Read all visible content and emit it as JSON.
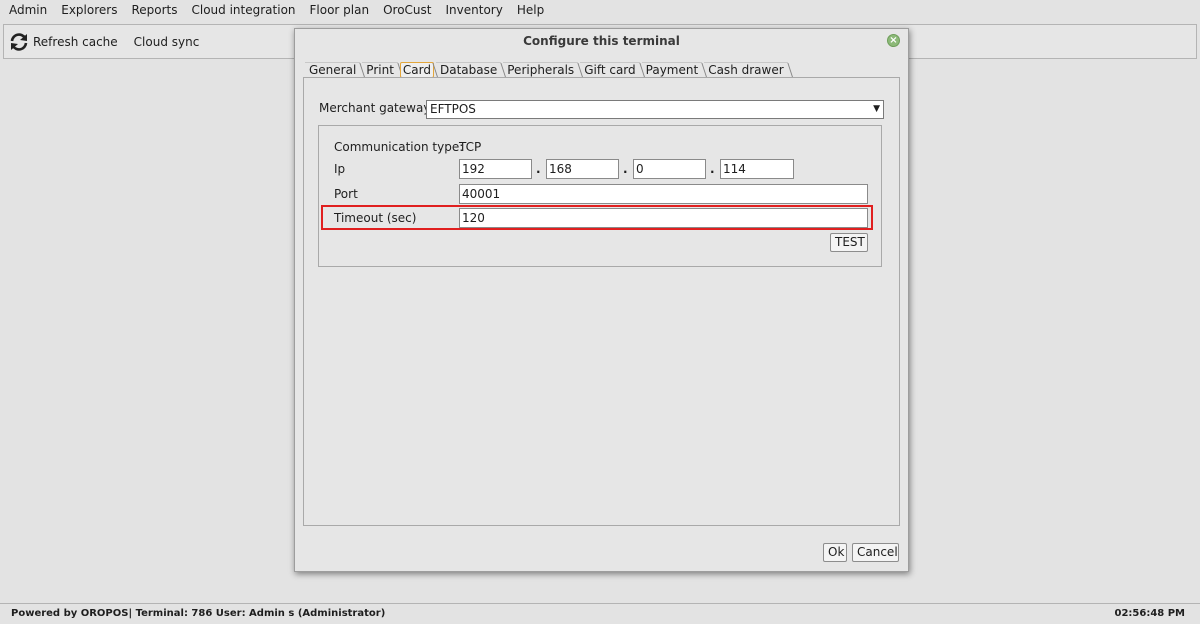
{
  "menubar": {
    "items": [
      "Admin",
      "Explorers",
      "Reports",
      "Cloud integration",
      "Floor plan",
      "OroCust",
      "Inventory",
      "Help"
    ]
  },
  "toolbar": {
    "refresh_label": "Refresh cache",
    "refresh_icon": "refresh-icon",
    "cloud_sync_label": "Cloud sync"
  },
  "dialog": {
    "title": "Configure this terminal",
    "tabs": [
      "General",
      "Print",
      "Card",
      "Database",
      "Peripherals",
      "Gift card",
      "Payment",
      "Cash drawer"
    ],
    "active_tab": "Card",
    "merchant_gateway_label": "Merchant gateway",
    "merchant_gateway_value": "EFTPOS",
    "communication_type_label": "Communication type:",
    "communication_type_value": "TCP",
    "ip_label": "Ip",
    "ip_octets": [
      "192",
      "168",
      "0",
      "114"
    ],
    "ip_separator": ".",
    "port_label": "Port",
    "port_value": "40001",
    "timeout_label": "Timeout (sec)",
    "timeout_value": "120",
    "test_label": "TEST",
    "ok_label": "Ok",
    "cancel_label": "Cancel",
    "highlight_color": "#e01f1f",
    "active_tab_color": "#e3a63b"
  },
  "statusbar": {
    "left_text": "Powered by OROPOS| Terminal: 786 User: Admin s (Administrator)",
    "time": "02:56:48 PM"
  }
}
